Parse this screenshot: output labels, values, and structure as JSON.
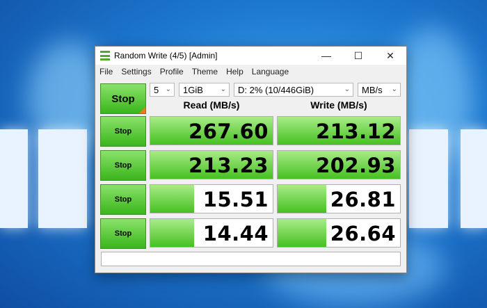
{
  "window": {
    "title": "Random Write (4/5) [Admin]"
  },
  "menu": [
    "File",
    "Settings",
    "Profile",
    "Theme",
    "Help",
    "Language"
  ],
  "controls": {
    "main_button": "Stop",
    "count": "5",
    "size": "1GiB",
    "drive": "D: 2% (10/446GiB)",
    "unit": "MB/s"
  },
  "headers": {
    "read": "Read (MB/s)",
    "write": "Write (MB/s)"
  },
  "rows": [
    {
      "button": "Stop",
      "read": "267.60",
      "write": "213.12",
      "read_fill": 1.0,
      "write_fill": 1.0
    },
    {
      "button": "Stop",
      "read": "213.23",
      "write": "202.93",
      "read_fill": 1.0,
      "write_fill": 1.0
    },
    {
      "button": "Stop",
      "read": "15.51",
      "write": "26.81",
      "read_fill": 0.36,
      "write_fill": 0.4
    },
    {
      "button": "Stop",
      "read": "14.44",
      "write": "26.64",
      "read_fill": 0.36,
      "write_fill": 0.4
    }
  ],
  "colors": {
    "accent_green": "#46c021",
    "corner_orange": "#f07a1e",
    "wallpaper_blue": "#1d78cf"
  }
}
